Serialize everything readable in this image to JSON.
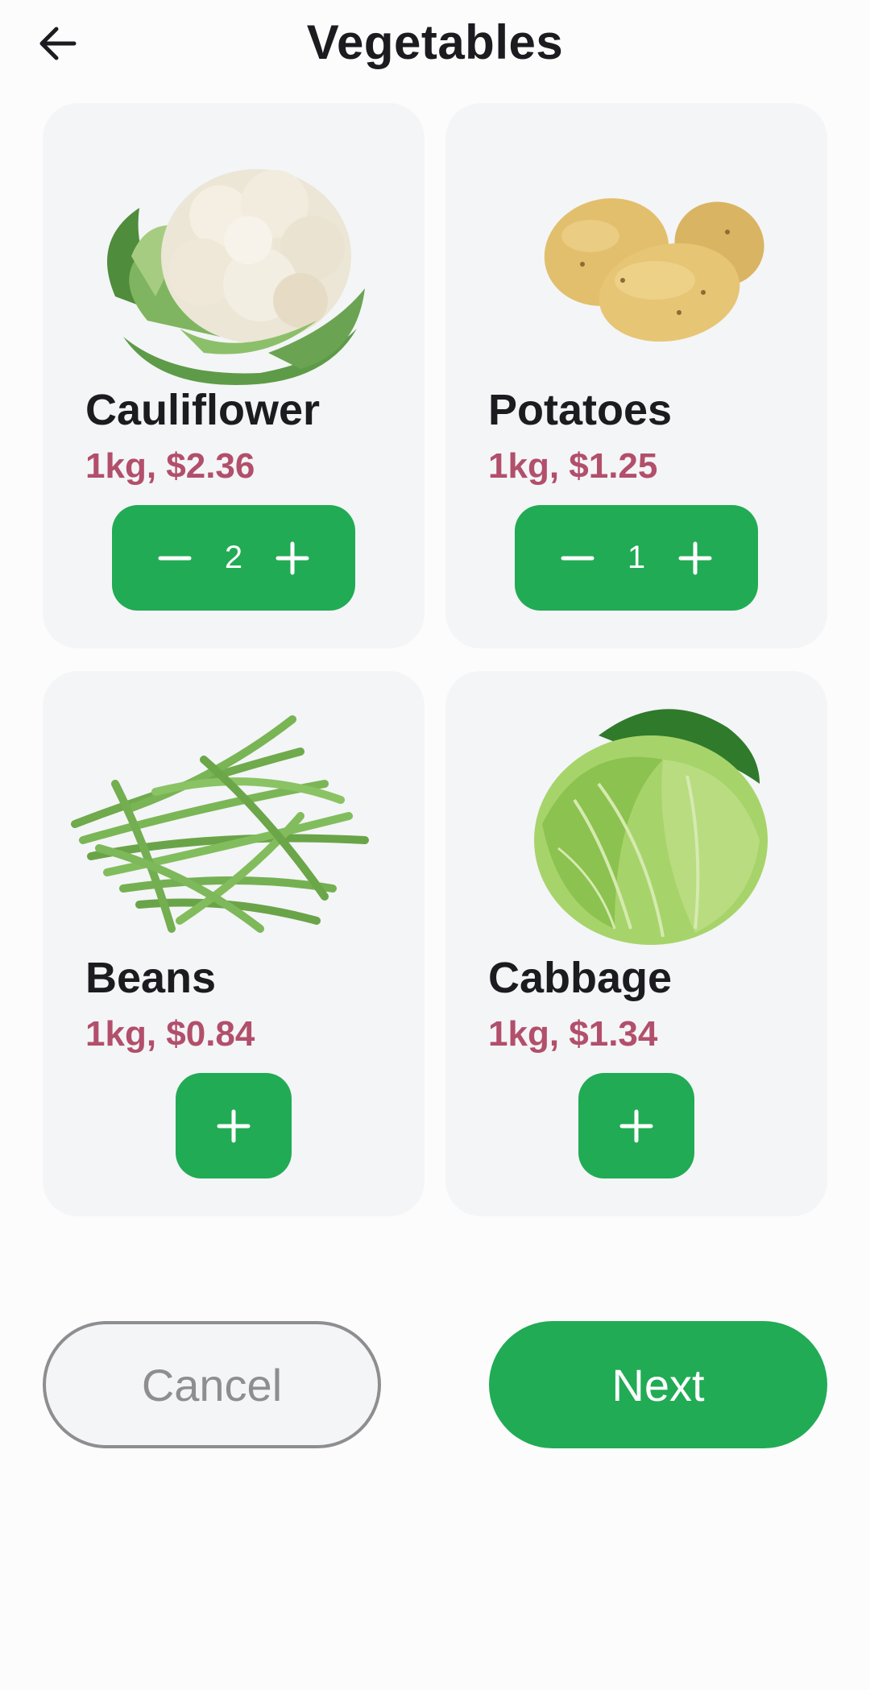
{
  "header": {
    "title": "Vegetables",
    "back_icon": "arrow-left-icon"
  },
  "products": [
    {
      "name": "Cauliflower",
      "price": "1kg, $2.36",
      "quantity": "2",
      "image": "cauliflower-image"
    },
    {
      "name": "Potatoes",
      "price": "1kg, $1.25",
      "quantity": "1",
      "image": "potatoes-image"
    },
    {
      "name": "Beans",
      "price": "1kg, $0.84",
      "image": "beans-image"
    },
    {
      "name": "Cabbage",
      "price": "1kg, $1.34",
      "image": "cabbage-image"
    }
  ],
  "actions": {
    "cancel_label": "Cancel",
    "next_label": "Next"
  },
  "colors": {
    "accent": "#21ab55",
    "price": "#b24f6b",
    "card_bg": "#f4f5f7",
    "text": "#1c1b20"
  }
}
